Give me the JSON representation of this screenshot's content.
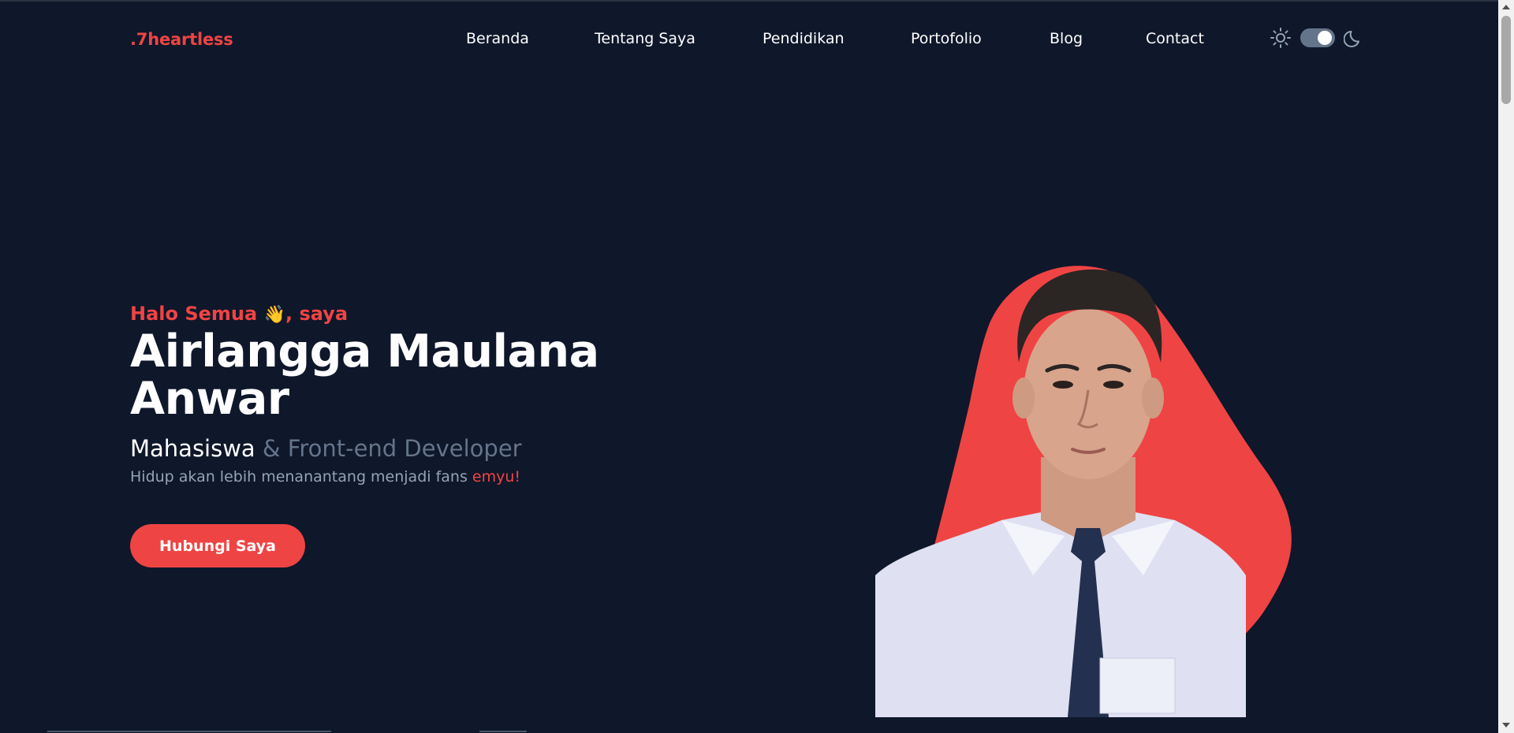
{
  "brand": {
    "logo_text": ".7heartless",
    "accent_color": "#ef4444",
    "background_color": "#0f172a"
  },
  "nav": {
    "items": [
      {
        "label": "Beranda"
      },
      {
        "label": "Tentang Saya"
      },
      {
        "label": "Pendidikan"
      },
      {
        "label": "Portofolio"
      },
      {
        "label": "Blog"
      },
      {
        "label": "Contact"
      }
    ]
  },
  "theme_toggle": {
    "light_icon": "sun-icon",
    "dark_icon": "moon-icon",
    "mode": "dark"
  },
  "hero": {
    "greeting_prefix": "Halo Semua ",
    "greeting_emoji": "👋",
    "greeting_suffix": ", saya",
    "name_line1": "Airlangga Maulana",
    "name_line2": "Anwar",
    "role_main": "Mahasiswa",
    "role_sub": " & Front-end Developer",
    "tagline_prefix": "Hidup akan lebih menanantang menjadi fans ",
    "tagline_accent": "emyu!",
    "cta_label": "Hubungi Saya"
  }
}
